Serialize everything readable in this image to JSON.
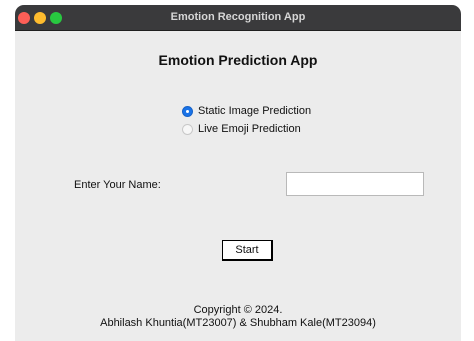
{
  "window": {
    "title": "Emotion Recognition App"
  },
  "app": {
    "title": "Emotion Prediction App"
  },
  "prediction_mode": {
    "options": [
      {
        "label": "Static Image Prediction",
        "selected": true
      },
      {
        "label": "Live Emoji Prediction",
        "selected": false
      }
    ]
  },
  "name_field": {
    "label": "Enter Your Name:",
    "value": ""
  },
  "start_button": {
    "label": "Start"
  },
  "footer": {
    "copyright": "Copyright © 2024.",
    "authors": "Abhilash Khuntia(MT23007) & Shubham Kale(MT23094)"
  },
  "colors": {
    "titlebar": "#3a3a3c",
    "window_bg": "#ececec",
    "radio_selected": "#1a73e8",
    "close": "#fe5f57",
    "minimize": "#febc2e",
    "maximize": "#28c840"
  }
}
